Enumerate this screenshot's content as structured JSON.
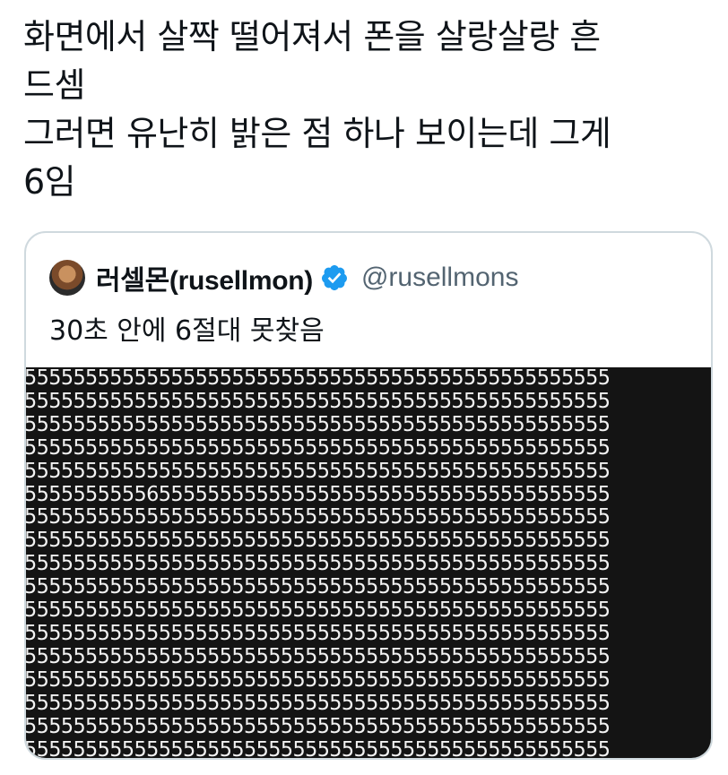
{
  "post": {
    "lines": [
      "화면에서 살짝 떨어져서 폰을 살랑살랑 흔",
      "드셈",
      "그러면 유난히 밝은 점 하나 보이는데 그게",
      "6임"
    ]
  },
  "quoted_tweet": {
    "display_name": "러셀몬(rusellmon)",
    "handle": "@rusellmons",
    "verified": true,
    "text": "30초 안에 6절대 못찾음",
    "image": {
      "rows": [
        "555555555555555555555555555555555555555555555555",
        "555555555555555555555555555555555555555555555555",
        "555555555555555555555555555555555555555555555555",
        "555555555555555555555555555555555555555555555555",
        "555555555555555555555555555555555555555555555555",
        "555555555565555555555555555555555555555555555555",
        "555555555555555555555555555555555555555555555555",
        "555555555555555555555555555555555555555555555555",
        "555555555555555555555555555555555555555555555555",
        "555555555555555555555555555555555555555555555555",
        "555555555555555555555555555555555555555555555555",
        "555555555555555555555555555555555555555555555555",
        "555555555555555555555555555555555555555555555555",
        "555555555555555555555555555555555555555555555555",
        "555555555555555555555555555555555555555555555555",
        "555555555555555555555555555555555555555555555555",
        "555555555555555555555555555555555555555555555555"
      ]
    }
  },
  "colors": {
    "text": "#0f1419",
    "secondary": "#536471",
    "verified_blue": "#1d9bf0",
    "card_border": "#cfd9de",
    "image_bg": "#141414",
    "digits": "#f2f2f2"
  }
}
